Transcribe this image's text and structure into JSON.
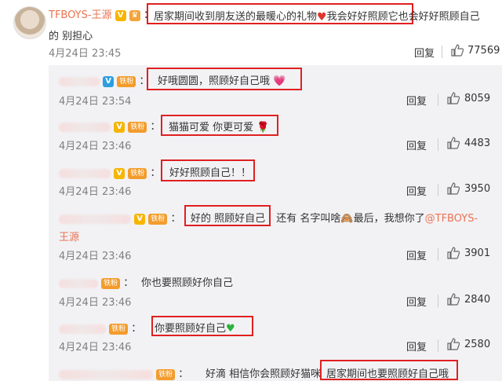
{
  "main": {
    "name": "TFBOYS-王源",
    "text_a": "居家期间收到朋友送的最暖心的礼物",
    "text_b": "我会好好照顾它",
    "text_c": "也会好好照顾自己",
    "text_d": "的 别担心",
    "time": "4月24日 23:45",
    "reply": "回复",
    "likes": "77569"
  },
  "replies": [
    {
      "prefix": "：",
      "text": "好哦圆圆，照顾好自己哦",
      "time": "4月24日 23:54",
      "reply": "回复",
      "likes": "8059"
    },
    {
      "prefix": "：",
      "text": "猫猫可爱 你更可爱",
      "time": "4月24日 23:46",
      "reply": "回复",
      "likes": "4483"
    },
    {
      "prefix": "：",
      "text": "好好照顾自己！！",
      "time": "4月24日 23:46",
      "reply": "回复",
      "likes": "3950"
    },
    {
      "prefix": "：",
      "text": "好的 照顾好自己",
      "text_b": "还有 名字叫啥",
      "text_c": "最后，我想你了",
      "mention_a": "@TFBOYS-",
      "mention_b": "王源",
      "time": "4月24日 23:46",
      "reply": "回复",
      "likes": "3901"
    },
    {
      "prefix": "：",
      "text": "你也要照顾好你自己",
      "time": "4月24日 23:46",
      "reply": "回复",
      "likes": "2840"
    },
    {
      "prefix": "：",
      "text": "你要照顾好自己",
      "time": "4月24日 23:46",
      "reply": "回复",
      "likes": "2580"
    },
    {
      "prefix": "：",
      "text_a": "好滴 相信你会照顾好猫咪",
      "text": "居家期间也要照顾好自己哦"
    }
  ],
  "badges": {
    "fan": "铁粉",
    "vip": "V"
  },
  "colors": {
    "link": "#eb7350",
    "highlight": "#e02020",
    "reply_bg": "#f2f2f5"
  }
}
